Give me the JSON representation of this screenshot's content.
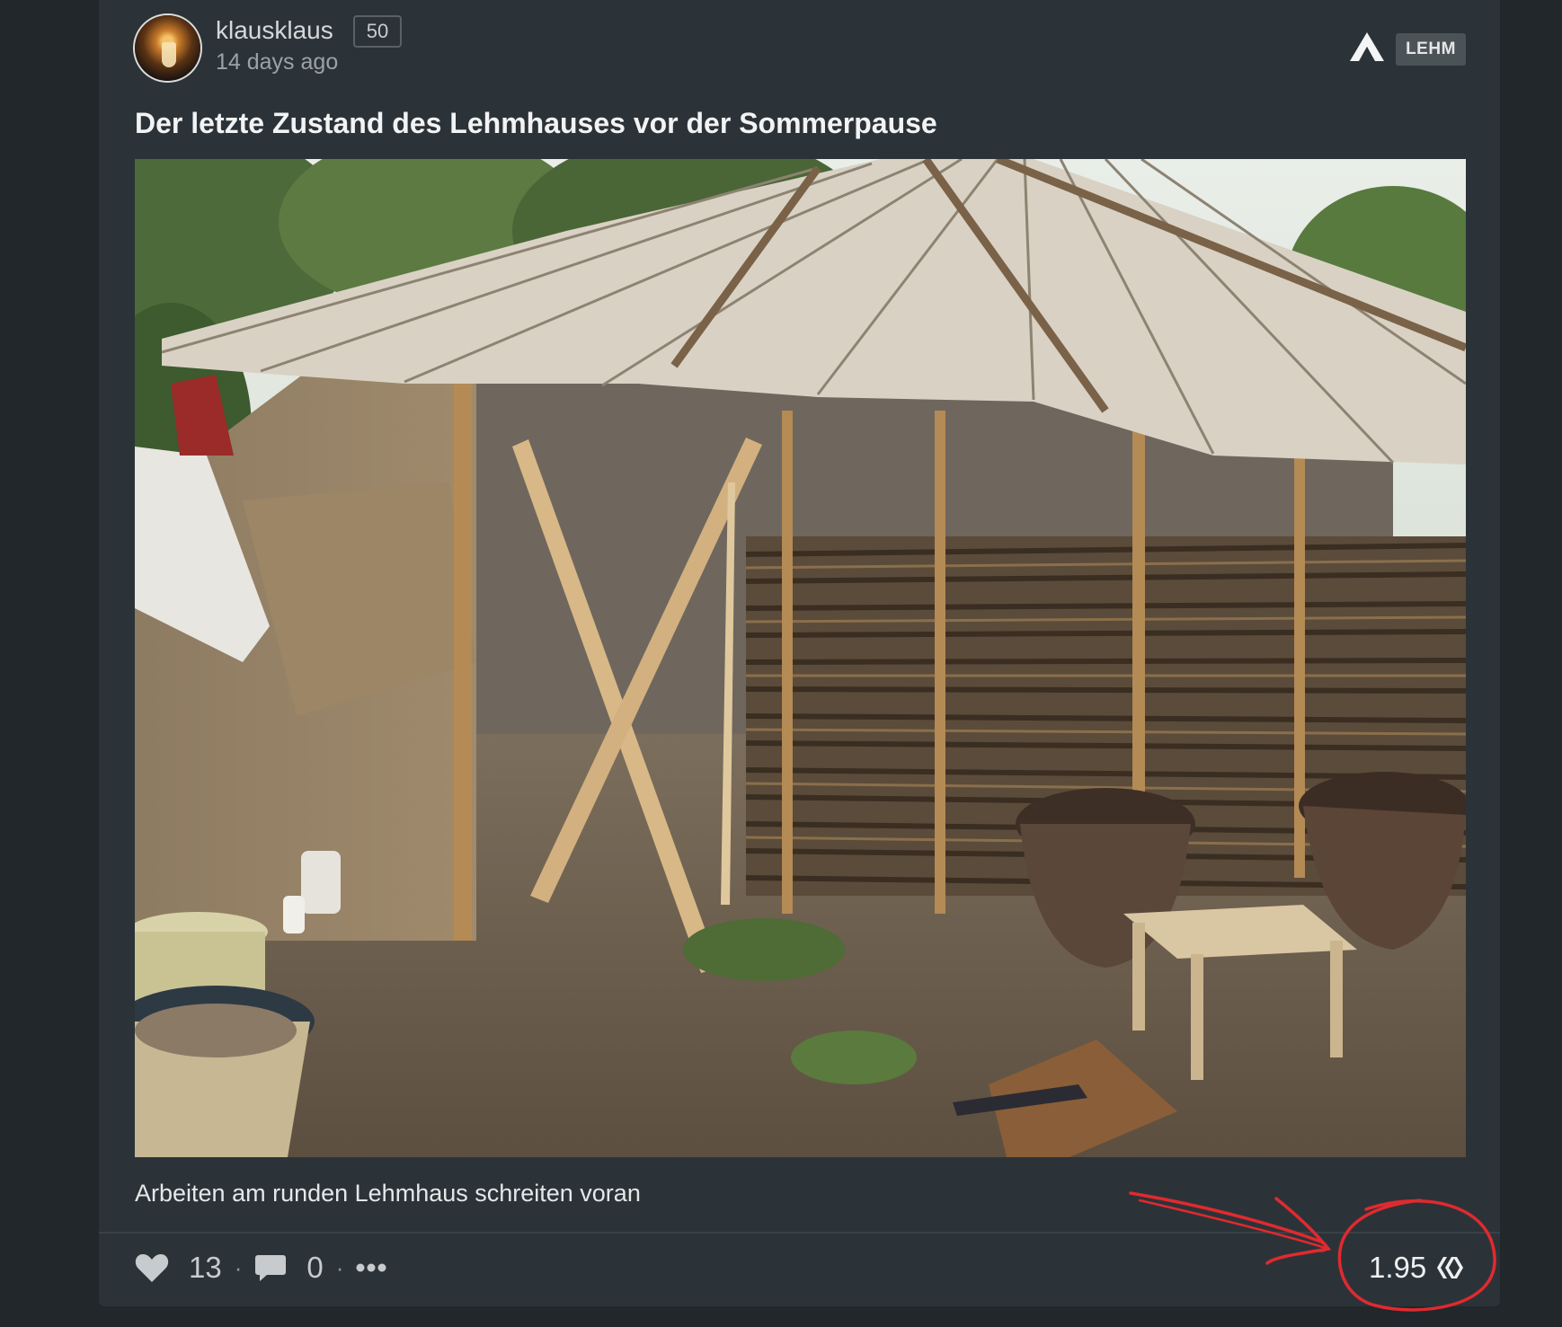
{
  "post": {
    "author": "klausklaus",
    "reputation": "50",
    "timestamp": "14 days ago",
    "community_tag": "LEHM",
    "title": "Der letzte Zustand des Lehmhauses vor der Sommerpause",
    "caption": "Arbeiten am runden Lehmhaus schreiten voran",
    "votes": "13",
    "comments": "0",
    "payout": "1.95"
  },
  "colors": {
    "background": "#21272b",
    "card": "#2c3338",
    "annotation_red": "#e02a2f"
  },
  "icons": [
    "avatar",
    "community-icon",
    "heart-icon",
    "comment-icon",
    "more-icon",
    "hive-icon"
  ]
}
